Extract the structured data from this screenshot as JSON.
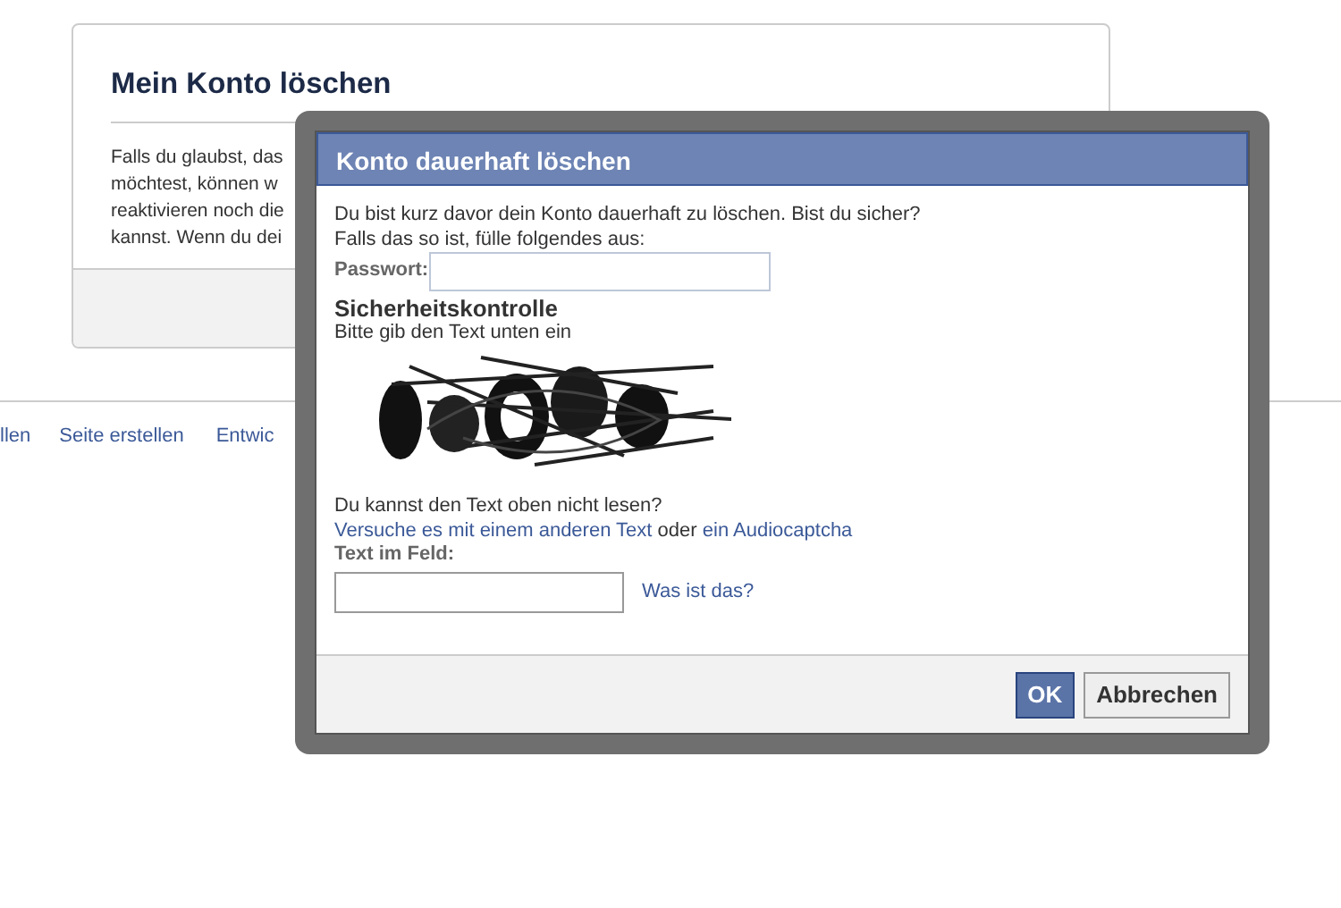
{
  "background_card": {
    "title": "Mein Konto löschen",
    "text_lines": [
      "Falls du glaubst, das",
      "möchtest, können w",
      "reaktivieren noch die",
      "kannst. Wenn du dei"
    ]
  },
  "footer_links": [
    "llen",
    "Seite erstellen",
    "Entwic"
  ],
  "dialog": {
    "title": "Konto dauerhaft löschen",
    "intro_lines": [
      "Du bist kurz davor dein Konto dauerhaft zu löschen. Bist du sicher?",
      "Falls das so ist, fülle folgendes aus:"
    ],
    "password_label": "Passwort:",
    "section_title": "Sicherheitskontrolle",
    "instruction": "Bitte gib den Text unten ein",
    "captcha": {
      "kind": "picture"
    },
    "cant_read": "Du kannst den Text oben nicht lesen?",
    "alternatives": [
      {
        "kind": "link",
        "text": "Versuche es mit einem anderen Text"
      },
      {
        "kind": "text",
        "text": "oder"
      },
      {
        "kind": "link",
        "text": "ein Audiocaptcha"
      }
    ],
    "field_label": "Text im Feld:",
    "help_link": "Was ist das?",
    "buttons": [
      {
        "label": "OK",
        "kind": "primary"
      },
      {
        "label": "Abbrechen",
        "kind": "secondary"
      }
    ]
  }
}
